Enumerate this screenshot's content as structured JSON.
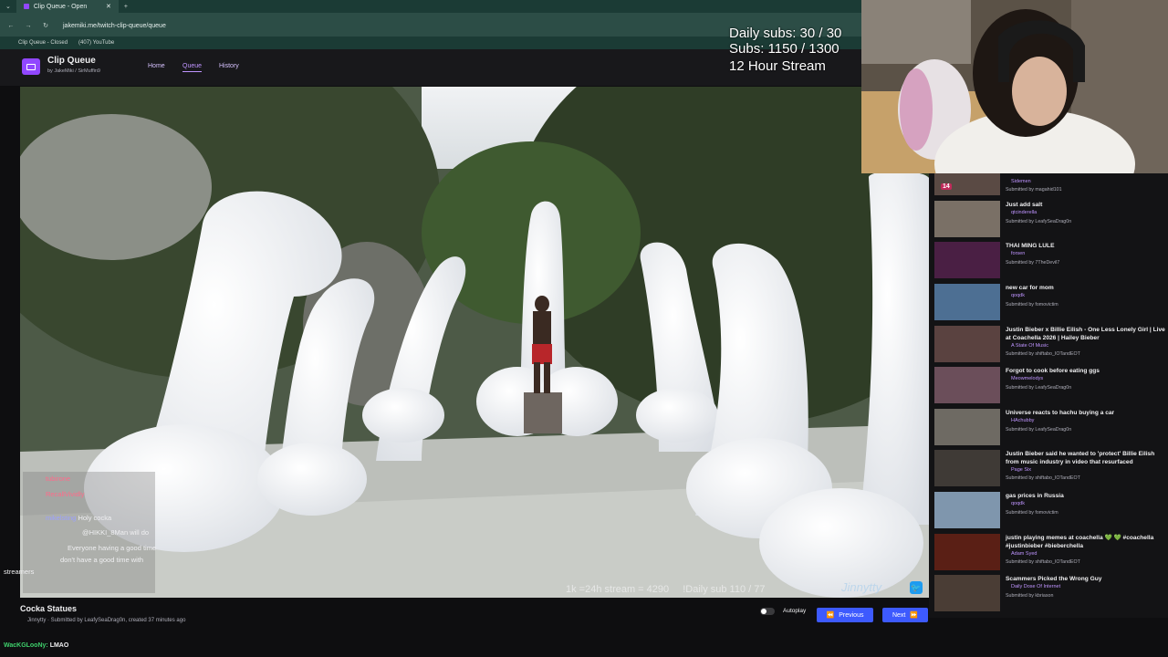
{
  "browser": {
    "tab_title": "Clip Queue - Open",
    "url": "jakemiki.me/twitch-clip-queue/queue",
    "bookmarks": [
      "Clip Queue - Closed",
      "(407) YouTube"
    ]
  },
  "app": {
    "title": "Clip Queue",
    "by_line": "by JakeMiki / SirMuffin9",
    "nav": [
      "Home",
      "Queue",
      "History"
    ],
    "active_nav": "Queue"
  },
  "goals": {
    "daily_subs": "Daily subs: 30 / 30",
    "subs": "Subs: 1150 / 1300",
    "stream": "12 Hour Stream"
  },
  "video": {
    "stats_left": "1k =24h stream = 4290",
    "stats_right": "!Daily sub 110 / 77",
    "watermark": "Jinnytty"
  },
  "queue": [
    {
      "title": "",
      "channel": "Sidemen",
      "submitted": "Submitted by magahid101",
      "badge": "14"
    },
    {
      "title": "Just add salt",
      "channel": "qtcinderella",
      "submitted": "Submitted by LeafySeaDrag0n"
    },
    {
      "title": "THAI MING LULE",
      "channel": "forsen",
      "submitted": "Submitted by 7TheDevil7"
    },
    {
      "title": "new car for mom",
      "channel": "qoqdk",
      "submitted": "Submitted by fomovictim"
    },
    {
      "title": "Justin Bieber x Billie Eilish - One Less Lonely Girl | Live at Coachella 2026 | Hailey Bieber",
      "channel": "A State Of Music",
      "submitted": "Submitted by shiftabo_IOTandEOT"
    },
    {
      "title": "Forgot to cook before eating ggs",
      "channel": "Meowmelodys",
      "submitted": "Submitted by LeafySeaDrag0n"
    },
    {
      "title": "Universe reacts to hachu buying a car",
      "channel": "HAchubby",
      "submitted": "Submitted by LeafySeaDrag0n"
    },
    {
      "title": "Justin Bieber said he wanted to 'protect' Billie Eilish from music industry in video that resurfaced",
      "channel": "Page Six",
      "submitted": "Submitted by shiftabo_IOTandEOT"
    },
    {
      "title": "gas prices in Russia",
      "channel": "qoqdk",
      "submitted": "Submitted by fomovictim"
    },
    {
      "title": "justin playing memes at coachella 💚 💚 #coachella #justinbieber #bieberchella",
      "channel": "Adam Syed",
      "submitted": "Submitted by shiftabo_IOTandEOT"
    },
    {
      "title": "Scammers Picked the Wrong Guy",
      "channel": "Daily Dose Of Internet",
      "submitted": "Submitted by kbriason"
    }
  ],
  "chat": {
    "lines": [
      {
        "name": "tubirone",
        "text": ""
      },
      {
        "name": "RecallVividly",
        "text": ""
      },
      {
        "name": "mikelsting",
        "text": "Holy cocka"
      },
      {
        "name": "",
        "text": "@HIKKI_8Man will do"
      },
      {
        "name": "",
        "text": "Everyone having a good time"
      },
      {
        "name": "",
        "text": "don't have a good time with"
      },
      {
        "name": "",
        "text": "streamers"
      }
    ],
    "bottom_name": "WacKGLooNy:",
    "bottom_text": "LMAO"
  },
  "clip_info": {
    "title": "Cocka Statues",
    "meta": "Jinnytty · Submitted by LeafySeaDrag0n, created 37 minutes ago"
  },
  "controls": {
    "autoplay": "Autoplay",
    "previous": "Previous",
    "next": "Next",
    "accent": "#3d5afe"
  }
}
